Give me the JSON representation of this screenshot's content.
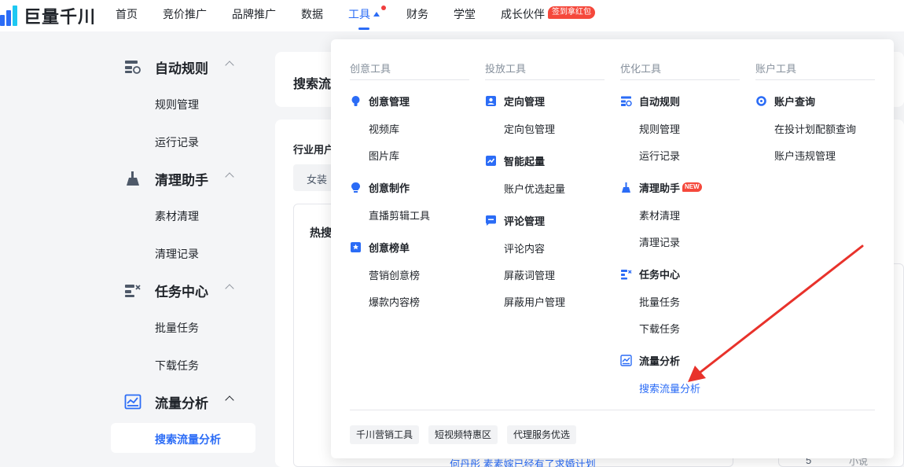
{
  "app": {
    "logo_text": "巨量千川"
  },
  "topnav": {
    "items": [
      "首页",
      "竞价推广",
      "品牌推广",
      "数据",
      "工具",
      "财务",
      "学堂",
      "成长伙伴"
    ],
    "promo_badge": "签到拿红包"
  },
  "sidebar": {
    "groups": [
      {
        "label": "自动规则",
        "items": [
          "规则管理",
          "运行记录"
        ]
      },
      {
        "label": "清理助手",
        "items": [
          "素材清理",
          "清理记录"
        ]
      },
      {
        "label": "任务中心",
        "items": [
          "批量任务",
          "下载任务"
        ]
      },
      {
        "label": "流量分析",
        "items": [
          "搜索流量分析"
        ]
      }
    ]
  },
  "background": {
    "card_title": "搜索流",
    "label": "行业用户",
    "tag": "女装",
    "box_title": "热搜",
    "bottom_text": "何丹彤    素素嫁已经有了求婚计划",
    "num": "5",
    "small": "小说"
  },
  "dropdown": {
    "columns": [
      {
        "title": "创意工具",
        "sections": [
          {
            "label": "创意管理",
            "icon": "bulb-icon",
            "links": [
              "视频库",
              "图片库"
            ]
          },
          {
            "label": "创意制作",
            "icon": "lightbulb-icon",
            "links": [
              "直播剪辑工具"
            ]
          },
          {
            "label": "创意榜单",
            "icon": "rank-icon",
            "links": [
              "营销创意榜",
              "爆款内容榜"
            ]
          }
        ]
      },
      {
        "title": "投放工具",
        "sections": [
          {
            "label": "定向管理",
            "icon": "user-target-icon",
            "links": [
              "定向包管理"
            ]
          },
          {
            "label": "智能起量",
            "icon": "trend-up-icon",
            "links": [
              "账户优选起量"
            ]
          },
          {
            "label": "评论管理",
            "icon": "comment-icon",
            "links": [
              "评论内容",
              "屏蔽词管理",
              "屏蔽用户管理"
            ]
          }
        ]
      },
      {
        "title": "优化工具",
        "sections": [
          {
            "label": "自动规则",
            "icon": "rule-icon",
            "links": [
              "规则管理",
              "运行记录"
            ]
          },
          {
            "label": "清理助手",
            "icon": "broom-icon",
            "badge": "NEW",
            "links": [
              "素材清理",
              "清理记录"
            ]
          },
          {
            "label": "任务中心",
            "icon": "task-icon",
            "links": [
              "批量任务",
              "下载任务"
            ]
          },
          {
            "label": "流量分析",
            "icon": "chart-icon",
            "links": [
              "搜索流量分析"
            ]
          }
        ]
      },
      {
        "title": "账户工具",
        "sections": [
          {
            "label": "账户查询",
            "icon": "search-gear-icon",
            "links": [
              "在投计划配额查询",
              "账户违规管理"
            ]
          }
        ]
      }
    ],
    "footer_chips": [
      "千川营销工具",
      "短视频特惠区",
      "代理服务优选"
    ]
  },
  "colors": {
    "accent": "#2b6cf6",
    "promo": "#f5483b",
    "arrow": "#e8322b"
  }
}
